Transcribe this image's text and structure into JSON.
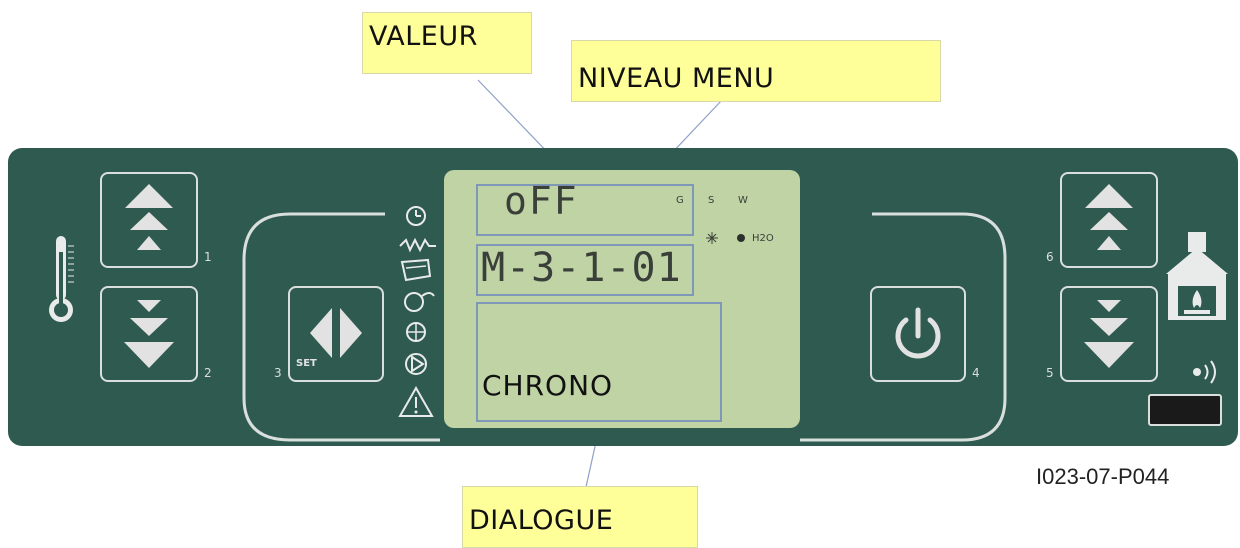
{
  "callouts": {
    "valeur": "VALEUR",
    "niveau_menu": "NIVEAU MENU",
    "dialogue": "DIALOGUE"
  },
  "display": {
    "value": "oFF",
    "menu_level": "M-3-1-01",
    "dialog": "CHRONO",
    "indicator_g": "G",
    "indicator_s": "S",
    "indicator_w": "W",
    "indicator_h2o": "H2O"
  },
  "buttons": {
    "num_1": "1",
    "num_2": "2",
    "num_3": "3",
    "num_4": "4",
    "num_5": "5",
    "num_6": "6",
    "set_label": "SET"
  },
  "reference_code": "I023-07-P044",
  "icons": {
    "thermometer": "thermometer-icon",
    "fireplace": "fireplace-icon",
    "wireless": "wireless-icon",
    "status_column": [
      "clock-icon",
      "resistance-icon",
      "pellet-icon",
      "fan-icon",
      "snowflake-fan-icon",
      "pump-icon",
      "warning-icon"
    ]
  },
  "colors": {
    "panel": "#2f5a50",
    "lcd": "#bfd3a4",
    "callout": "#ffff99",
    "outline": "#d9dfdc",
    "arrow": "#e2e2e2"
  }
}
